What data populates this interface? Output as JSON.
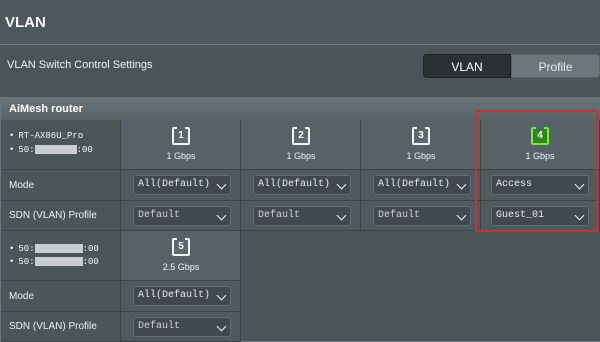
{
  "page": {
    "title": "VLAN",
    "subtitle": "VLAN Switch Control Settings"
  },
  "tabs": {
    "vlan": "VLAN",
    "profile": "Profile"
  },
  "section": {
    "title": "AiMesh router"
  },
  "router1": {
    "model": "RT-AX86U_Pro",
    "mac_prefix": "50:",
    "mac_suffix": ":00",
    "ports": [
      {
        "number": "1",
        "speed": "1 Gbps",
        "mode": "All(Default)",
        "profile": "Default"
      },
      {
        "number": "2",
        "speed": "1 Gbps",
        "mode": "All(Default)",
        "profile": "Default"
      },
      {
        "number": "3",
        "speed": "1 Gbps",
        "mode": "All(Default)",
        "profile": "Default"
      },
      {
        "number": "4",
        "speed": "1 Gbps",
        "mode": "Access",
        "profile": "Guest_01"
      }
    ]
  },
  "router2": {
    "mac1_prefix": "50:",
    "mac1_suffix": ":00",
    "mac2_prefix": "50:",
    "mac2_suffix": ":00",
    "ports": [
      {
        "number": "5",
        "speed": "2.5 Gbps",
        "mode": "All(Default)",
        "profile": "Default"
      }
    ]
  },
  "labels": {
    "mode": "Mode",
    "sdn_profile": "SDN (VLAN) Profile"
  },
  "colors": {
    "highlight": "#d62b2b",
    "active_port": "#2d8a12"
  }
}
